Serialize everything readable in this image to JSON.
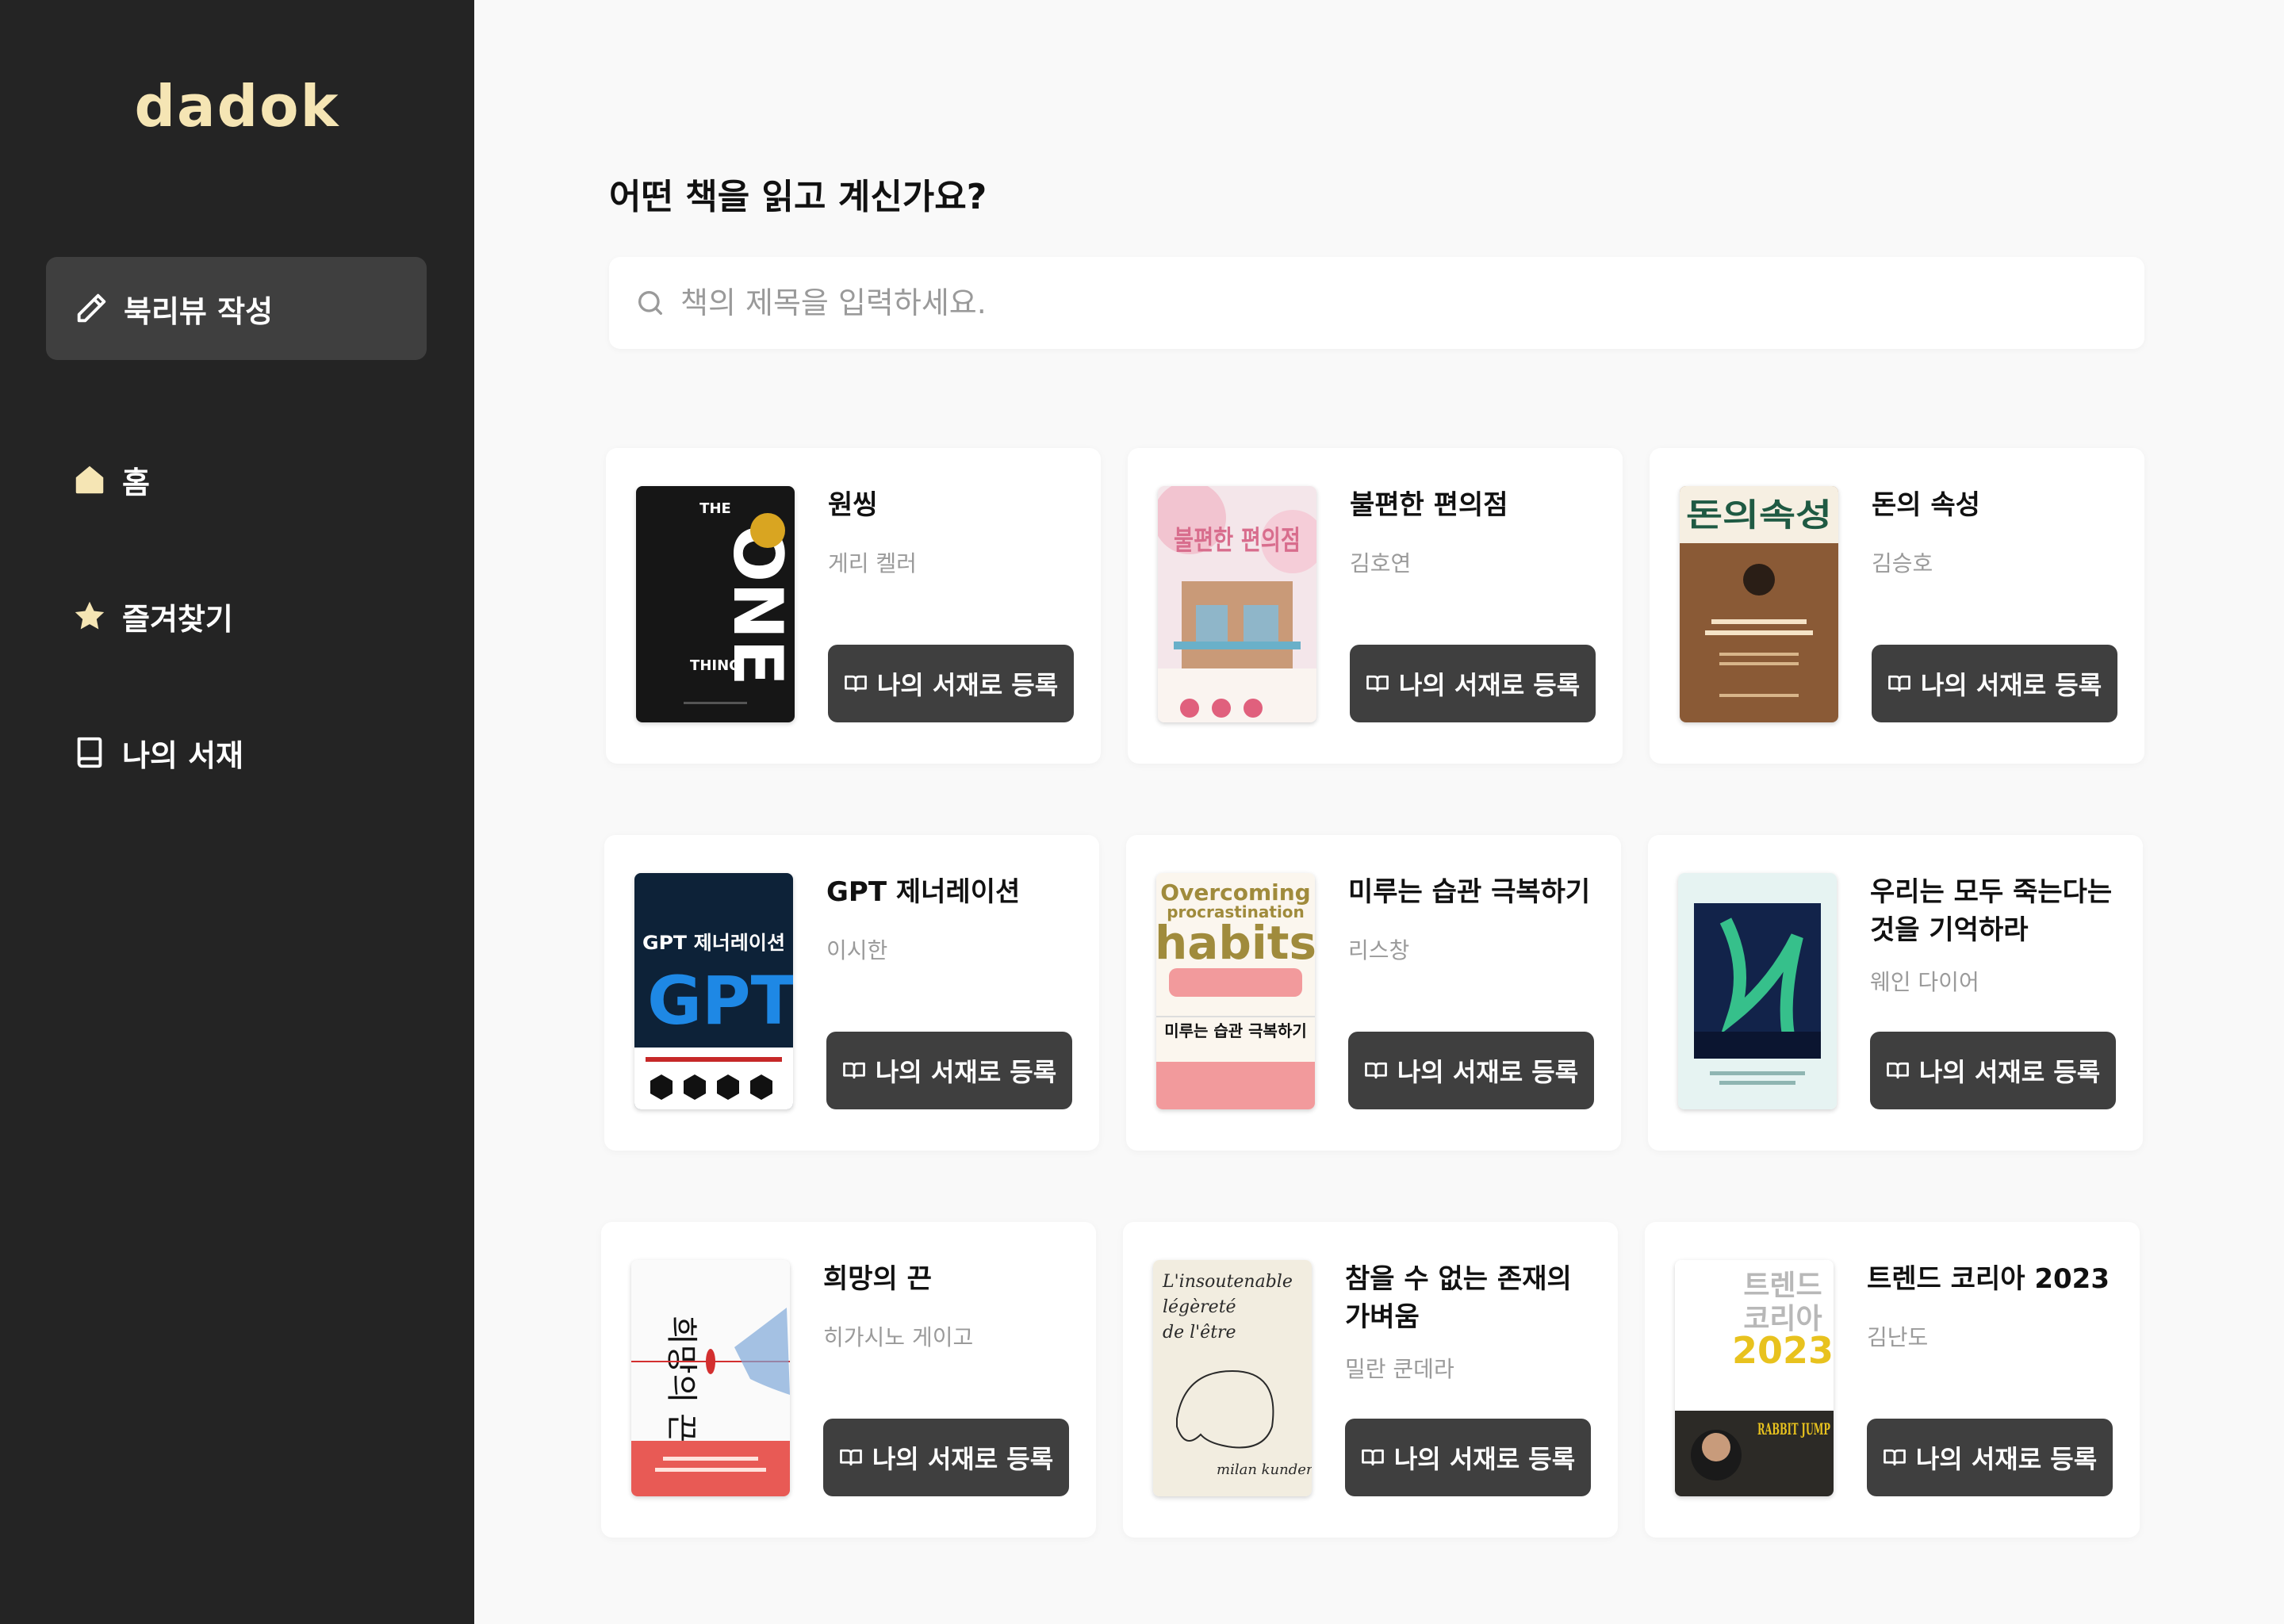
{
  "app": {
    "logo": "dadok"
  },
  "sidebar": {
    "write_label": "북리뷰 작성",
    "items": [
      {
        "label": "홈",
        "icon": "home-icon"
      },
      {
        "label": "즐겨찾기",
        "icon": "star-icon"
      },
      {
        "label": "나의 서재",
        "icon": "bookshelf-icon"
      }
    ]
  },
  "main": {
    "title": "어떤 책을 읽고 계신가요?",
    "search": {
      "placeholder": "책의 제목을 입력하세요.",
      "value": ""
    }
  },
  "books": [
    {
      "title": "원씽",
      "author": "게리 켈러",
      "button": "나의 서재로 등록"
    },
    {
      "title": "불편한 편의점",
      "author": "김호연",
      "button": "나의 서재로 등록"
    },
    {
      "title": "돈의 속성",
      "author": "김승호",
      "button": "나의 서재로 등록"
    },
    {
      "title": "GPT 제너레이션",
      "author": "이시한",
      "button": "나의 서재로 등록"
    },
    {
      "title": "미루는 습관 극복하기",
      "author": "리스창",
      "button": "나의 서재로 등록"
    },
    {
      "title": "우리는 모두 죽는다는 것을 기억하라",
      "author": "웨인 다이어",
      "button": "나의 서재로 등록"
    },
    {
      "title": "희망의 끈",
      "author": "히가시노 게이고",
      "button": "나의 서재로 등록"
    },
    {
      "title": "참을 수 없는 존재의 가벼움",
      "author": "밀란 쿤데라",
      "button": "나의 서재로 등록"
    },
    {
      "title": "트렌드 코리아 2023",
      "author": "김난도",
      "button": "나의 서재로 등록"
    }
  ],
  "covers": {
    "one_thing": {
      "line1": "THE",
      "line2": "ONE",
      "line3": "THING"
    },
    "money": {
      "title": "돈의속성"
    },
    "gpt": {
      "top": "GPT 제너레이션",
      "big": "GPT"
    },
    "habits": {
      "en1": "Overcoming",
      "en2": "procrastination",
      "en3": "habits",
      "ko": "미루는 습관 극복하기"
    },
    "hope": {
      "title": "희망의 끈"
    },
    "kundera": {
      "line1": "L'insoutenable",
      "line2": "légèreté",
      "line3": "de l'être",
      "author": "milan kundera"
    },
    "trend": {
      "line1": "트렌드",
      "line2": "코리아",
      "line3": "2023",
      "tag": "RABBIT JUMP"
    }
  },
  "colors": {
    "sidebar_bg": "#242424",
    "logo": "#f5e5b4",
    "page_bg": "#f9f9f9",
    "button_bg": "#3f3f3f",
    "star": "#f5e5b4"
  }
}
